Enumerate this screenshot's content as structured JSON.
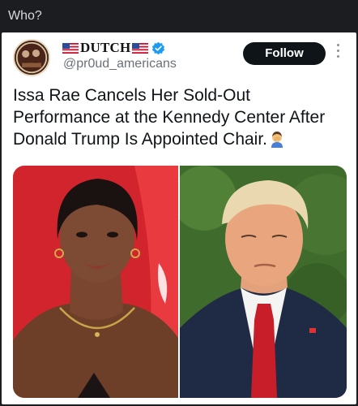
{
  "window": {
    "title": "Who?"
  },
  "post": {
    "author": {
      "display_name": "DUTCH",
      "handle": "@pr0ud_americans",
      "verified": true,
      "flag_icon": "us-flag-icon"
    },
    "follow_label": "Follow",
    "text": "Issa Rae Cancels Her Sold-Out Performance at the Kennedy Center After Donald Trump Is Appointed Chair.",
    "emoji": "person-facepalming-icon",
    "media": [
      {
        "name": "photo-issa-rae",
        "subject": "woman on red carpet"
      },
      {
        "name": "photo-donald-trump",
        "subject": "man in suit with red tie"
      }
    ]
  },
  "colors": {
    "topbar_bg": "#1c1d21",
    "card_bg": "#ffffff",
    "follow_bg": "#0f1419",
    "verified_blue": "#1d9bf0",
    "handle_gray": "#6b7178"
  }
}
